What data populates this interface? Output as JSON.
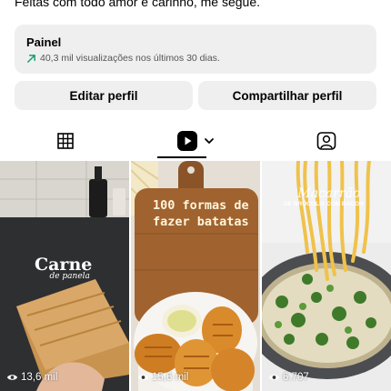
{
  "profile": {
    "bio_line": "Feitas com todo amor e carinho, me segue."
  },
  "dashboard": {
    "title": "Painel",
    "subtitle": "40,3 mil visualizações nos últimos 30 dias.",
    "trend_icon": "trend-up-arrow-icon",
    "trend_color": "#1a9b6f"
  },
  "actions": {
    "edit_label": "Editar perfil",
    "share_label": "Compartilhar perfil"
  },
  "tabs": [
    {
      "icon": "grid-icon",
      "active": false
    },
    {
      "icon": "reels-icon",
      "active": true
    },
    {
      "icon": "tagged-icon",
      "active": false
    }
  ],
  "reels": [
    {
      "title": "Carne",
      "subtitle": "de panela",
      "views": "13,6 mil",
      "icon": "eye-icon"
    },
    {
      "title": "100 formas de",
      "subtitle": "fazer batatas",
      "views": "15,6 mil",
      "icon": "eye-icon"
    },
    {
      "title": "Macarrão",
      "subtitle": "DE BRÓCOLIS COM BACON",
      "views": "6.707",
      "icon": "eye-icon"
    }
  ]
}
